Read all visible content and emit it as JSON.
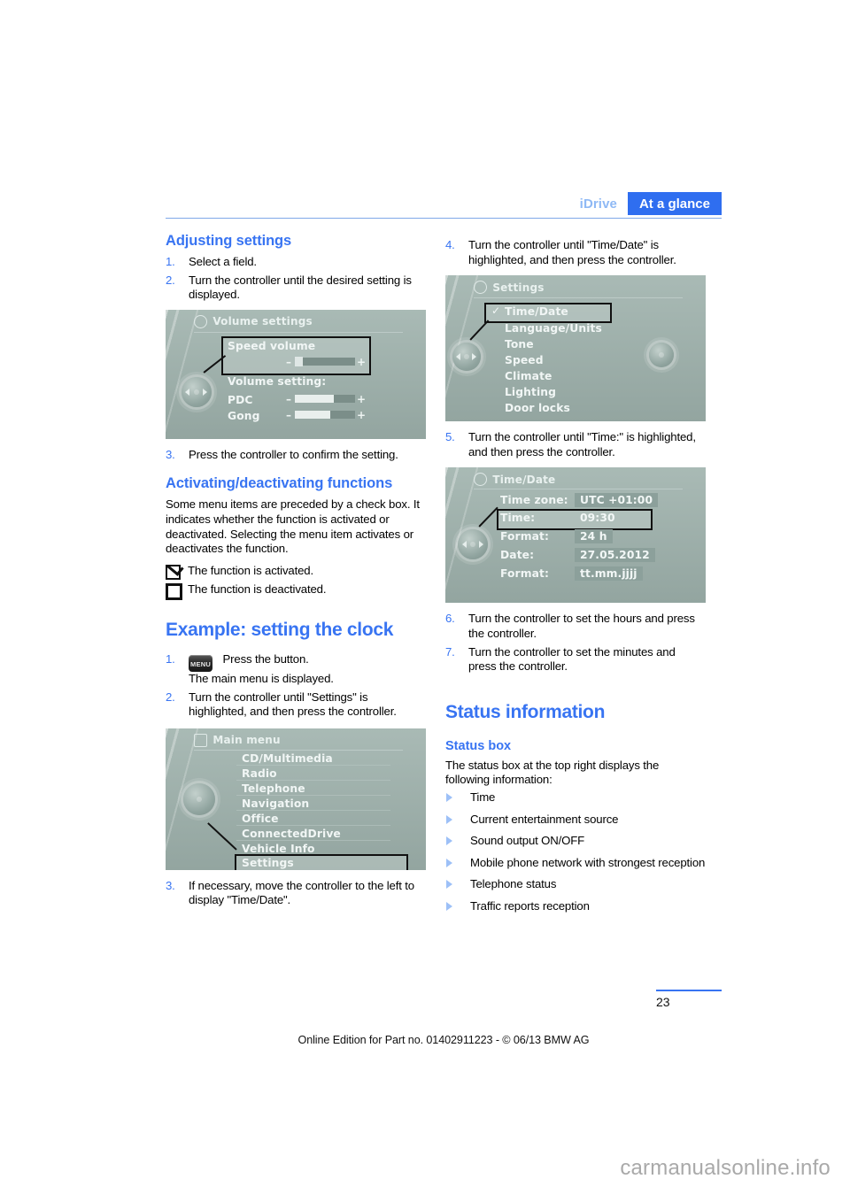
{
  "header": {
    "chapter": "iDrive",
    "section": "At a glance"
  },
  "left_column": {
    "heading_adjusting": "Adjusting settings",
    "steps_adjusting": [
      {
        "num": "1.",
        "text": "Select a field."
      },
      {
        "num": "2.",
        "text": "Turn the controller until the desired setting is displayed."
      }
    ],
    "step3": {
      "num": "3.",
      "text": "Press the controller to confirm the setting."
    },
    "heading_activating": "Activating/deactivating functions",
    "paragraph_activating": "Some menu items are preceded by a check box. It indicates whether the function is activated or deactivated. Selecting the menu item activates or deactivates the function.",
    "checkbox_on_text": "The function is activated.",
    "checkbox_off_text": "The function is deactivated.",
    "heading_example": "Example: setting the clock",
    "example_steps": [
      {
        "num": "1.",
        "icon": "menu-button-icon",
        "icon_label": "MENU",
        "text": "Press the button.",
        "text2": "The main menu is displayed."
      },
      {
        "num": "2.",
        "text": "Turn the controller until \"Settings\" is highlighted, and then press the controller."
      }
    ],
    "example_step3": {
      "num": "3.",
      "text": "If necessary, move the controller to the left to display \"Time/Date\"."
    }
  },
  "right_column": {
    "step4": {
      "num": "4.",
      "text": "Turn the controller until \"Time/Date\" is highlighted, and then press the controller."
    },
    "step5": {
      "num": "5.",
      "text": "Turn the controller until \"Time:\" is highlighted, and then press the controller."
    },
    "step6": {
      "num": "6.",
      "text": "Turn the controller to set the hours and press the controller."
    },
    "step7": {
      "num": "7.",
      "text": "Turn the controller to set the minutes and press the controller."
    },
    "heading_status_information": "Status information",
    "heading_status_box": "Status box",
    "paragraph_status_box": "The status box at the top right displays the following information:",
    "status_bullets": [
      "Time",
      "Current entertainment source",
      "Sound output ON/OFF",
      "Mobile phone network with strongest reception",
      "Telephone status",
      "Traffic reports reception"
    ]
  },
  "screenshots": {
    "volume_settings": {
      "title": "Volume settings",
      "selected_label": "Speed volume",
      "section_label": "Volume setting:",
      "rows": [
        {
          "label": "PDC",
          "minus": "–",
          "plus": "+"
        },
        {
          "label": "Gong",
          "minus": "–",
          "plus": "+"
        }
      ],
      "minus": "–",
      "plus": "+"
    },
    "settings_menu": {
      "title": "Settings",
      "items": [
        "Time/Date",
        "Language/Units",
        "Tone",
        "Speed",
        "Climate",
        "Lighting",
        "Door locks"
      ],
      "selected_index": 0,
      "check_glyph": "✓"
    },
    "time_date": {
      "title": "Time/Date",
      "rows": [
        {
          "label": "Time zone:",
          "value": "UTC +01:00"
        },
        {
          "label": "Time:",
          "value": "09:30"
        },
        {
          "label": "Format:",
          "value": "24 h"
        },
        {
          "label": "Date:",
          "value": "27.05.2012"
        },
        {
          "label": "Format:",
          "value": "tt.mm.jjjj"
        }
      ],
      "selected_index": 1
    },
    "main_menu": {
      "title": "Main menu",
      "items": [
        "CD/Multimedia",
        "Radio",
        "Telephone",
        "Navigation",
        "Office",
        "ConnectedDrive",
        "Vehicle Info",
        "Settings"
      ],
      "selected_index": 7
    }
  },
  "footer": {
    "page_number": "23",
    "online_edition": "Online Edition for Part no. 01402911223 - © 06/13 BMW AG",
    "watermark": "carmanualsonline.info"
  },
  "colors": {
    "accent_blue": "#3874f2",
    "header_blue": "#2f6ef0",
    "chapter_blue": "#8fb9f5",
    "bullet_blue": "#9dc0f7"
  }
}
